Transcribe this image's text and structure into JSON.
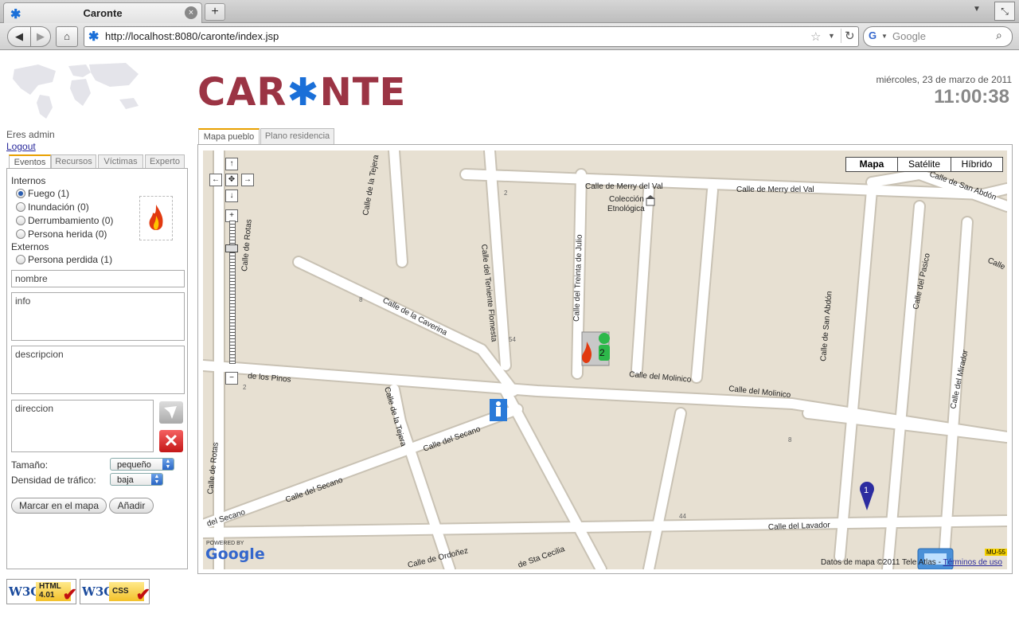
{
  "browser": {
    "tab_title": "Caronte",
    "new_tab_label": "+",
    "url": "http://localhost:8080/caronte/index.jsp",
    "search_placeholder": "Google"
  },
  "header": {
    "logo_pre": "CAR",
    "logo_post": "NTE",
    "date": "miércoles, 23 de marzo de 2011",
    "time": "11:00:38"
  },
  "user": {
    "greeting": "Eres admin",
    "logout": "Logout"
  },
  "left_tabs": [
    "Eventos",
    "Recursos",
    "Víctimas",
    "Experto"
  ],
  "events": {
    "internos_label": "Internos",
    "internos": [
      "Fuego (1)",
      "Inundación (0)",
      "Derrumbamiento (0)",
      "Persona herida (0)"
    ],
    "externos_label": "Externos",
    "externos": [
      "Persona perdida (1)"
    ],
    "selected": "Fuego (1)"
  },
  "form": {
    "nombre": "nombre",
    "info": "info",
    "descripcion": "descripcion",
    "direccion": "direccion",
    "tamano_label": "Tamaño:",
    "tamano_value": "pequeño",
    "densidad_label": "Densidad de tráfico:",
    "densidad_value": "baja",
    "marcar_button": "Marcar en el mapa",
    "anadir_button": "Añadir"
  },
  "map_tabs": [
    "Mapa pueblo",
    "Plano residencia"
  ],
  "map": {
    "types": [
      "Mapa",
      "Satélite",
      "Híbrido"
    ],
    "active_type": "Mapa",
    "streets": [
      "Calle de Merry del Val",
      "Calle de Merry del Val",
      "Calle de San Abdón",
      "Calle de la Tejera",
      "Colección",
      "Etnológica",
      "Calle del Treinta de Julio",
      "Calle del Teniente Flomesta",
      "Calle de la Caverina",
      "Calle de Rotas",
      "de los Pinos",
      "Calle del Molinico",
      "Calle del Molinico",
      "Calle de San Abdón",
      "Calle del Pasico",
      "Calle del Mirador",
      "Calle de la Tejera",
      "Calle del Secano",
      "Calle del Secano",
      "del Secano",
      "Calle de Rotas",
      "Calle del Lavador",
      "Calle de Ordoñez",
      "de Sta Cecilia",
      "Calle"
    ],
    "numbers": [
      "2",
      "54",
      "8",
      "2",
      "8",
      "44"
    ],
    "powered_by": "POWERED BY",
    "google_logo": "Google",
    "attribution": "Datos de mapa ©2011 Tele Atlas - ",
    "terms": "Términos de uso",
    "road_shield": "MU-55",
    "markers": {
      "fire_cluster": "2",
      "pin": "1"
    }
  },
  "badges": [
    {
      "name": "W3C",
      "text1": "HTML",
      "text2": "4.01"
    },
    {
      "name": "W3C",
      "text1": "CSS",
      "text2": ""
    }
  ],
  "colors": {
    "logo": "#9b3444",
    "accent": "#1a6fd8",
    "map_bg": "#e7e0d2",
    "road": "#ffffff",
    "tab_highlight": "#e8a000"
  }
}
